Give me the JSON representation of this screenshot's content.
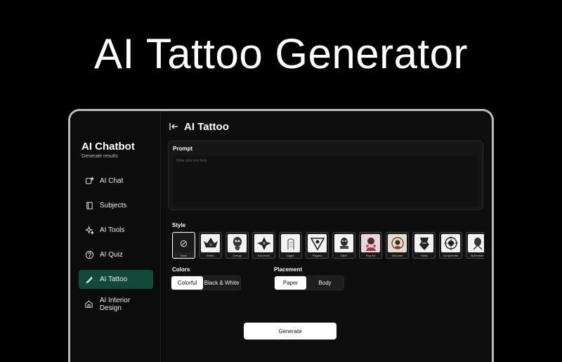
{
  "headline": "AI Tattoo Generator",
  "window": {
    "controls": [
      {
        "name": "close",
        "color": "#ff5f57"
      },
      {
        "name": "minimize",
        "color": "#febc2e"
      },
      {
        "name": "maximize",
        "color": "#28c840"
      }
    ]
  },
  "sidebar": {
    "title": "AI Chatbot",
    "subtitle": "Generate results",
    "items": [
      {
        "label": "AI Chat",
        "icon": "chat-sparkle-icon"
      },
      {
        "label": "Subjects",
        "icon": "book-icon"
      },
      {
        "label": "AI Tools",
        "icon": "sparkles-icon"
      },
      {
        "label": "AI Quiz",
        "icon": "question-icon"
      },
      {
        "label": "AI Tattoo",
        "icon": "tattoo-pen-icon",
        "active": true
      },
      {
        "label": "AI Interior Design",
        "icon": "home-icon"
      }
    ]
  },
  "main": {
    "title": "AI Tattoo",
    "back_icon": "back-arrow-icon",
    "prompt": {
      "label": "Prompt",
      "placeholder": "Write your text here"
    },
    "style": {
      "label": "Style",
      "options": [
        "None",
        "Gothic",
        "Creepy",
        "Bio-mech",
        "Egypt",
        "Pagano",
        "Glitch",
        "Pop Art",
        "Victorian",
        "Tribal",
        "Ornamental",
        "Bohemian"
      ],
      "selected": "None"
    },
    "colors": {
      "label": "Colors",
      "options": [
        "Colorful",
        "Black & White"
      ],
      "selected": "Colorful"
    },
    "placement": {
      "label": "Placement",
      "options": [
        "Paper",
        "Body"
      ],
      "selected": "Paper"
    },
    "generate_label": "Generate"
  },
  "theme": {
    "accent": "#114a39",
    "background": "#000000"
  }
}
